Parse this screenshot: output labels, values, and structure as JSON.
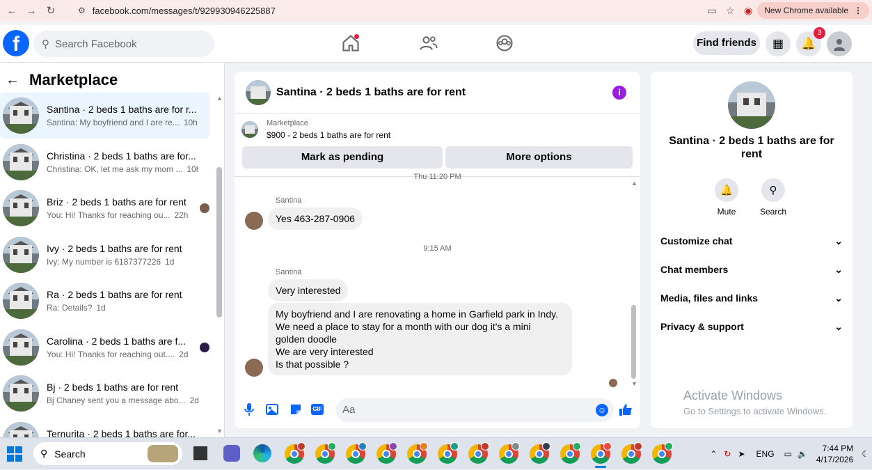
{
  "browser": {
    "url": "facebook.com/messages/t/929930946225887",
    "new_chrome": "New Chrome available"
  },
  "fb": {
    "search_placeholder": "Search Facebook",
    "find_friends": "Find friends",
    "notif_count": "3"
  },
  "sidebar": {
    "title": "Marketplace",
    "conversations": [
      {
        "title": "Santina · 2 beds 1 baths are for r...",
        "preview": "Santina: My boyfriend and I are re...",
        "time": "10h"
      },
      {
        "title": "Christina · 2 beds 1 baths are for...",
        "preview": "Christina: OK, let me ask my mom ...",
        "time": "10h"
      },
      {
        "title": "Briz · 2 beds 1 baths are for rent",
        "preview": "You: Hi! Thanks for reaching ou...",
        "time": "22h"
      },
      {
        "title": "Ivy · 2 beds 1 baths are for rent",
        "preview": "Ivy: My number is 6187377226",
        "time": "1d"
      },
      {
        "title": "Ra · 2 beds 1 baths are for rent",
        "preview": "Ra: Details?",
        "time": "1d"
      },
      {
        "title": "Carolina · 2 beds 1 baths are f...",
        "preview": "You: Hi! Thanks for reaching out....",
        "time": "2d"
      },
      {
        "title": "Bj · 2 beds 1 baths are for rent",
        "preview": "Bj Chaney sent you a message abo...",
        "time": "2d"
      },
      {
        "title": "Ternurita · 2 beds 1 baths are for...",
        "preview": "",
        "time": ""
      }
    ]
  },
  "chat": {
    "title": "Santina · 2 beds 1 baths are for rent",
    "listing_label": "Marketplace",
    "listing_price": "$900 - 2 beds 1 baths are for rent",
    "mark_pending": "Mark as pending",
    "more_options": "More options",
    "cut_timestamp": "Thu 11:20 PM",
    "sender1": "Santina",
    "msg1": "Yes 463-287-0906",
    "timestamp2": "9:15 AM",
    "sender2": "Santina",
    "msg2": "Very interested",
    "msg3_lines": [
      "My boyfriend and I are renovating a home in Garfield park in Indy.",
      "We need a place to stay for a month with our dog it's a mini",
      "golden doodle",
      "We are very interested",
      "Is that possible ?"
    ],
    "composer_placeholder": "Aa"
  },
  "info": {
    "name": "Santina · 2 beds 1 baths are for rent",
    "mute": "Mute",
    "search": "Search",
    "rows": [
      "Customize chat",
      "Chat members",
      "Media, files and links",
      "Privacy & support"
    ],
    "activate_title": "Activate Windows",
    "activate_sub": "Go to Settings to activate Windows."
  },
  "taskbar": {
    "search": "Search",
    "lang": "ENG",
    "time": "7:44 PM",
    "date": "4/17/2026"
  },
  "colors": {
    "fb_blue": "#0866ff",
    "badge_red": "#e41e3f",
    "info_purple": "#9a1ee0"
  }
}
